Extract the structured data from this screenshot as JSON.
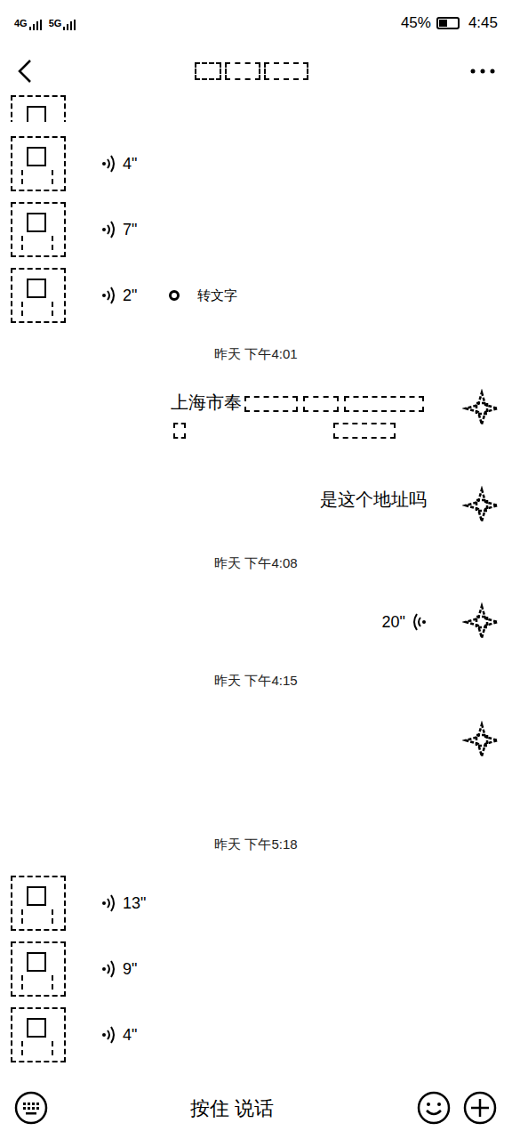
{
  "status_bar": {
    "network": [
      "4G",
      "5G"
    ],
    "battery": "45%",
    "battery_level": 0.45,
    "time": "4:45"
  },
  "messages": [
    {
      "kind": "partial",
      "side": "left"
    },
    {
      "kind": "voice",
      "side": "left",
      "duration": "4\""
    },
    {
      "kind": "voice",
      "side": "left",
      "duration": "7\""
    },
    {
      "kind": "voice",
      "side": "left",
      "duration": "2\"",
      "convert_label": "转文字"
    },
    {
      "kind": "time",
      "text": "昨天 下午4:01"
    },
    {
      "kind": "text",
      "side": "right",
      "text": "上海市奉",
      "redacted": true
    },
    {
      "kind": "text",
      "side": "right",
      "text": "是这个地址吗",
      "redacted": false
    },
    {
      "kind": "time",
      "text": "昨天 下午4:08"
    },
    {
      "kind": "voice",
      "side": "right",
      "duration": "20\""
    },
    {
      "kind": "time",
      "text": "昨天 下午4:15"
    },
    {
      "kind": "blank",
      "side": "right"
    },
    {
      "kind": "time",
      "text": "昨天 下午5:18"
    },
    {
      "kind": "voice",
      "side": "left",
      "duration": "13\""
    },
    {
      "kind": "voice",
      "side": "left",
      "duration": "9\""
    },
    {
      "kind": "voice",
      "side": "left",
      "duration": "4\""
    }
  ],
  "input_bar": {
    "hold_to_talk": "按住 说话"
  }
}
